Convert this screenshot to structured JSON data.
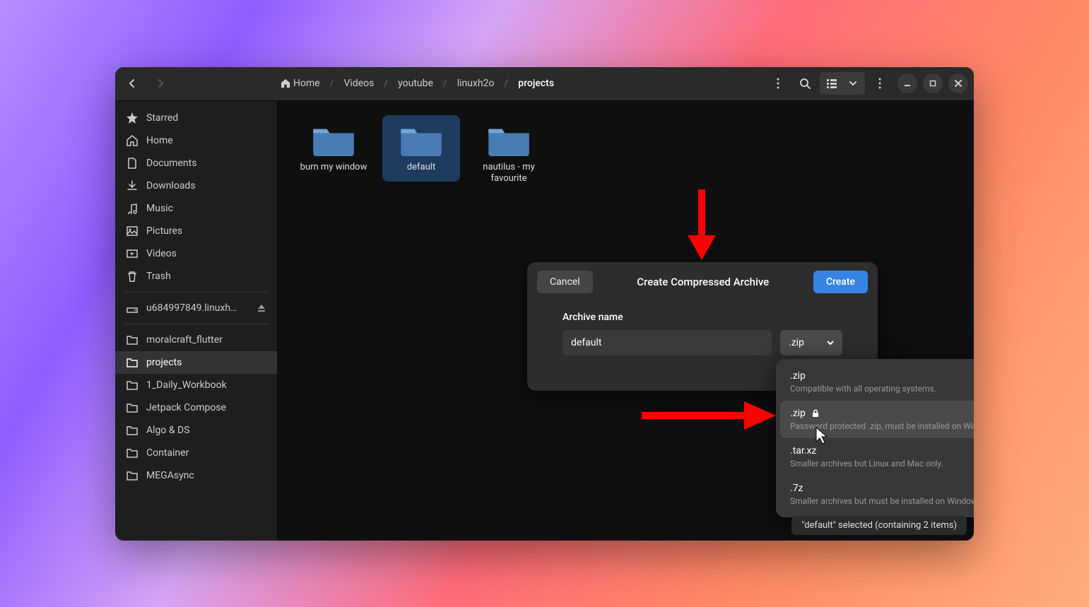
{
  "breadcrumbs": [
    {
      "label": "Home",
      "icon": "home"
    },
    {
      "label": "Videos"
    },
    {
      "label": "youtube"
    },
    {
      "label": "linuxh2o"
    },
    {
      "label": "projects",
      "active": true
    }
  ],
  "sidebar": {
    "top": [
      {
        "name": "starred",
        "label": "Starred",
        "icon": "star"
      },
      {
        "name": "home",
        "label": "Home",
        "icon": "home"
      },
      {
        "name": "documents",
        "label": "Documents",
        "icon": "document"
      },
      {
        "name": "downloads",
        "label": "Downloads",
        "icon": "download"
      },
      {
        "name": "music",
        "label": "Music",
        "icon": "music"
      },
      {
        "name": "pictures",
        "label": "Pictures",
        "icon": "picture"
      },
      {
        "name": "videos",
        "label": "Videos",
        "icon": "video"
      },
      {
        "name": "trash",
        "label": "Trash",
        "icon": "trash"
      }
    ],
    "mount": {
      "label": "u684997849.linuxh…",
      "eject": true
    },
    "folders": [
      {
        "name": "moralcraft",
        "label": "moralcraft_flutter"
      },
      {
        "name": "projects",
        "label": "projects",
        "active": true
      },
      {
        "name": "daily",
        "label": "1_Daily_Workbook"
      },
      {
        "name": "jetpack",
        "label": "Jetpack Compose"
      },
      {
        "name": "algo",
        "label": "Algo & DS"
      },
      {
        "name": "container",
        "label": "Container"
      },
      {
        "name": "mega",
        "label": "MEGAsync"
      }
    ]
  },
  "files": [
    {
      "name": "burn my window",
      "selected": false
    },
    {
      "name": "default",
      "selected": true
    },
    {
      "name": "nautilus - my favourite",
      "selected": false
    }
  ],
  "dialog": {
    "title": "Create Compressed Archive",
    "cancel": "Cancel",
    "create": "Create",
    "field_label": "Archive name",
    "value": "default",
    "ext": ".zip"
  },
  "popover": {
    "items": [
      {
        "title": ".zip",
        "desc": "Compatible with all operating systems.",
        "checked": true,
        "lock": false,
        "hovered": false
      },
      {
        "title": ".zip",
        "desc": "Password protected .zip, must be installed on Windows and Mac.",
        "checked": false,
        "lock": true,
        "hovered": true
      },
      {
        "title": ".tar.xz",
        "desc": "Smaller archives but Linux and Mac only.",
        "checked": false,
        "lock": false,
        "hovered": false
      },
      {
        "title": ".7z",
        "desc": "Smaller archives but must be installed on Windows and Mac.",
        "checked": false,
        "lock": false,
        "hovered": false
      }
    ]
  },
  "statusbar": "\"default\" selected  (containing 2 items)"
}
